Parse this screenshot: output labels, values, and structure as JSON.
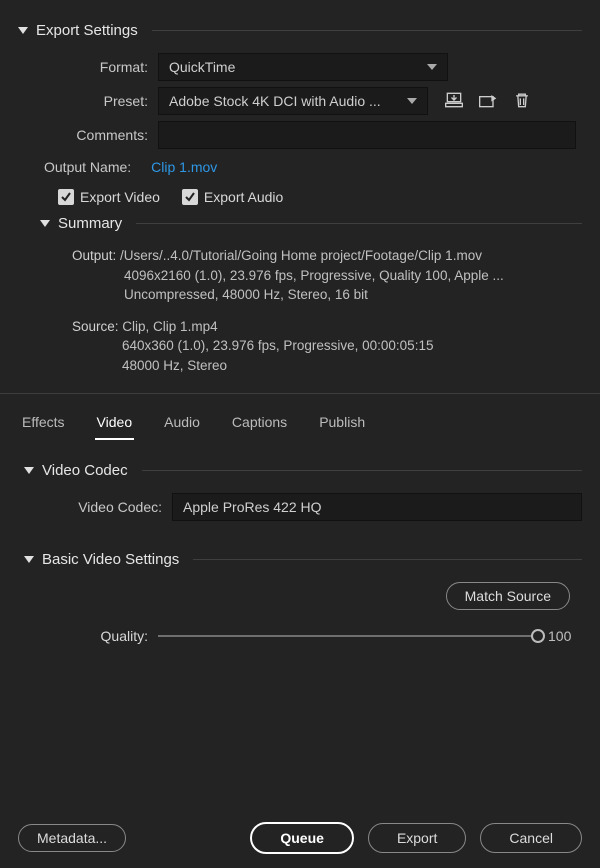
{
  "export_settings_title": "Export Settings",
  "format": {
    "label": "Format:",
    "value": "QuickTime"
  },
  "preset": {
    "label": "Preset:",
    "value": "Adobe Stock 4K DCI with Audio ..."
  },
  "comments": {
    "label": "Comments:"
  },
  "output_name": {
    "label": "Output Name:",
    "value": "Clip 1.mov"
  },
  "export_video_label": "Export Video",
  "export_audio_label": "Export Audio",
  "summary_title": "Summary",
  "summary": {
    "output_label": "Output:",
    "output_path": "/Users/..4.0/Tutorial/Going Home project/Footage/Clip 1.mov",
    "output_line2": "4096x2160 (1.0), 23.976 fps, Progressive, Quality 100, Apple ...",
    "output_line3": "Uncompressed, 48000 Hz, Stereo, 16 bit",
    "source_label": "Source:",
    "source_name": "Clip, Clip 1.mp4",
    "source_line2": "640x360 (1.0), 23.976 fps, Progressive, 00:00:05:15",
    "source_line3": "48000 Hz, Stereo"
  },
  "tabs": {
    "effects": "Effects",
    "video": "Video",
    "audio": "Audio",
    "captions": "Captions",
    "publish": "Publish"
  },
  "video_codec_title": "Video Codec",
  "video_codec": {
    "label": "Video Codec:",
    "value": "Apple ProRes 422 HQ"
  },
  "basic_video_title": "Basic Video Settings",
  "match_source": "Match Source",
  "quality": {
    "label": "Quality:",
    "value": "100"
  },
  "buttons": {
    "metadata": "Metadata...",
    "queue": "Queue",
    "export": "Export",
    "cancel": "Cancel"
  }
}
